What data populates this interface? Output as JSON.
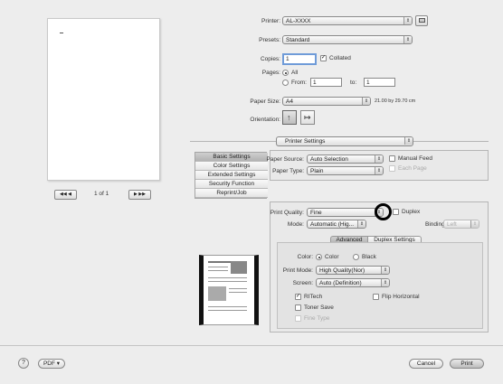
{
  "preview": {
    "page_label": "1 of 1",
    "nav_prev": "◀◀  ◀",
    "nav_next": "▶  ▶▶"
  },
  "printer": {
    "label": "Printer:",
    "value": "AL-XXXX"
  },
  "presets": {
    "label": "Presets:",
    "value": "Standard"
  },
  "copies": {
    "label": "Copies:",
    "value": "1",
    "collated_label": "Collated",
    "collated_checked": true
  },
  "pages": {
    "label": "Pages:",
    "all_label": "All",
    "from_label": "From:",
    "from_value": "1",
    "to_label": "to:",
    "to_value": "1"
  },
  "paper_size": {
    "label": "Paper Size:",
    "value": "A4",
    "dimensions": "21.00 by 29.70 cm"
  },
  "orientation": {
    "label": "Orientation:"
  },
  "section_popup": {
    "value": "Printer Settings"
  },
  "side_tabs": [
    "Basic Settings",
    "Color Settings",
    "Extended Settings",
    "Security Function",
    "Reprint/Job"
  ],
  "paper_source": {
    "label": "Paper Source:",
    "value": "Auto Selection",
    "manual_feed_label": "Manual Feed",
    "each_page_label": "Each Page"
  },
  "paper_type": {
    "label": "Paper Type:",
    "value": "Plain"
  },
  "print_quality": {
    "label": "Print Quality:",
    "value": "Fine",
    "duplex_label": "Duplex"
  },
  "mode": {
    "label": "Mode:",
    "value": "Automatic (Hig...",
    "binding_label": "Binding:",
    "binding_value": "Left"
  },
  "sub_tabs": [
    "Advanced",
    "Duplex Settings"
  ],
  "color": {
    "label": "Color:",
    "color_option": "Color",
    "black_option": "Black"
  },
  "print_mode": {
    "label": "Print Mode:",
    "value": "High Quality(Nor)"
  },
  "screen": {
    "label": "Screen:",
    "value": "Auto (Definition)"
  },
  "options": {
    "rittech_label": "RITech",
    "flip_label": "Flip Horizontal",
    "toner_save_label": "Toner Save",
    "fine_type_label": "Fine Type"
  },
  "footer": {
    "help": "?",
    "pdf_label": "PDF ▾",
    "cancel_label": "Cancel",
    "print_label": "Print"
  }
}
